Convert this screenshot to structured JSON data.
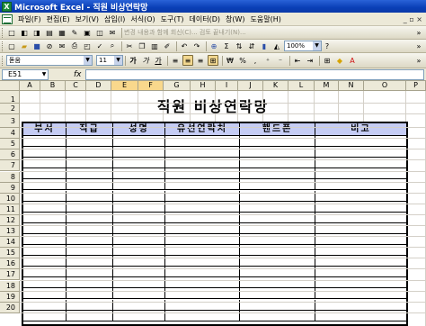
{
  "window": {
    "title": "Microsoft Excel - 직원 비상연락망",
    "app_icon": "excel-icon"
  },
  "menu": {
    "items": [
      "파일(F)",
      "편집(E)",
      "보기(V)",
      "삽입(I)",
      "서식(O)",
      "도구(T)",
      "데이터(D)",
      "창(W)",
      "도움말(H)"
    ],
    "right": "_ ▫ ×"
  },
  "toolbar2": {
    "review_text": "변경 내용과 함께 회신(C)... 검토 끝내기(N)..."
  },
  "toolbar1": {
    "zoom": "100%"
  },
  "toolbar3": {
    "font": "돋움",
    "size": "11",
    "bold": "가",
    "italic": "가",
    "underline": "가"
  },
  "formula": {
    "namebox": "E51",
    "fx": "fx",
    "value": ""
  },
  "columns": [
    "A",
    "B",
    "C",
    "D",
    "E",
    "F",
    "G",
    "H",
    "I",
    "J",
    "K",
    "L",
    "M",
    "N",
    "O",
    "P"
  ],
  "selected_columns": [
    "E",
    "F"
  ],
  "rows": [
    "1",
    "2",
    "3",
    "4",
    "5",
    "6",
    "7",
    "8",
    "9",
    "10",
    "11",
    "12",
    "13",
    "14",
    "15",
    "16",
    "17",
    "18",
    "19",
    "20"
  ],
  "sheet": {
    "title": "직원 비상연락망",
    "headers": [
      "부서",
      "직급",
      "성명",
      "유선연락처",
      "핸드폰",
      "비고"
    ],
    "header_color": "#c5ccf4"
  }
}
